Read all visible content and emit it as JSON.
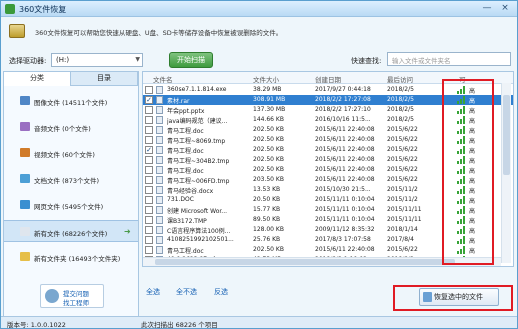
{
  "window": {
    "title": "360文件恢复",
    "minimize": "—",
    "close": "×"
  },
  "banner": {
    "text": "360文件恢复可以帮助您快速从硬盘、U盘、SD卡等储存设备中恢复被误删除的文件。"
  },
  "drivebar": {
    "drive_label": "选择驱动器:",
    "drive_value": "(H:)",
    "scan_button": "开始扫描",
    "search_label": "快速查找:",
    "search_placeholder": "输入文件或文件夹名"
  },
  "sidebar": {
    "tabs": [
      "分类",
      "目录"
    ],
    "active_tab": 0,
    "categories": [
      {
        "label": "图像文件 (14511个文件)",
        "icon": "image-icon",
        "color": "#4f86c6"
      },
      {
        "label": "音频文件 (0个文件)",
        "icon": "music-icon",
        "color": "#9a6fc2"
      },
      {
        "label": "视频文件 (60个文件)",
        "icon": "video-icon",
        "color": "#d07b2a"
      },
      {
        "label": "文档文件 (873个文件)",
        "icon": "document-icon",
        "color": "#4c9fd6"
      },
      {
        "label": "网页文件 (5495个文件)",
        "icon": "globe-icon",
        "color": "#3a8fd1"
      },
      {
        "label": "新有文件 (68226个文件)",
        "icon": "file-icon",
        "color": "#dfe6ee",
        "selected": true
      },
      {
        "label": "新有文件夹 (16493个文件夹)",
        "icon": "folder-icon",
        "color": "#e6bf4a"
      }
    ],
    "help": {
      "line1": "提交问题",
      "line2": "找工程师"
    }
  },
  "table": {
    "headers": {
      "name": "文件名",
      "size": "文件大小",
      "created": "创建日期",
      "accessed": "最后访问",
      "grade": "可"
    },
    "rows": [
      {
        "name": "360se7.1.1.814.exe",
        "size": "38.29 MB",
        "created": "2017/9/27 0:44:18",
        "accessed": "2018/2/5",
        "grade": "高",
        "checked": false
      },
      {
        "name": "素材.rar",
        "size": "308.91 MB",
        "created": "2018/2/2 17:27:08",
        "accessed": "2018/2/5",
        "grade": "高",
        "checked": true,
        "selected": true
      },
      {
        "name": "年会ppt.pptx",
        "size": "137.30 MB",
        "created": "2018/2/2 17:27:10",
        "accessed": "2018/2/5",
        "grade": "高",
        "checked": false
      },
      {
        "name": "java编码规范（建议...",
        "size": "144.66 KB",
        "created": "2016/10/16 11:5...",
        "accessed": "2018/2/5",
        "grade": "高",
        "checked": false
      },
      {
        "name": "青马工程.doc",
        "size": "202.50 KB",
        "created": "2015/6/11 22:40:08",
        "accessed": "2015/6/22",
        "grade": "高",
        "checked": false
      },
      {
        "name": "青马工程~8069.tmp",
        "size": "202.50 KB",
        "created": "2015/6/11 22:40:08",
        "accessed": "2015/6/22",
        "grade": "高",
        "checked": false
      },
      {
        "name": "青马工程.doc",
        "size": "202.50 KB",
        "created": "2015/6/11 22:40:08",
        "accessed": "2015/6/22",
        "grade": "高",
        "checked": true
      },
      {
        "name": "青马工程~304B2.tmp",
        "size": "202.50 KB",
        "created": "2015/6/11 22:40:08",
        "accessed": "2015/6/22",
        "grade": "高",
        "checked": false
      },
      {
        "name": "青马工程.doc",
        "size": "202.50 KB",
        "created": "2015/6/11 22:40:08",
        "accessed": "2015/6/22",
        "grade": "高",
        "checked": false
      },
      {
        "name": "青马工程~006FD.tmp",
        "size": "203.50 KB",
        "created": "2015/6/11 22:40:08",
        "accessed": "2015/6/22",
        "grade": "高",
        "checked": false
      },
      {
        "name": "青马经验谷.docx",
        "size": "13.53 KB",
        "created": "2015/10/30 21:5...",
        "accessed": "2015/11/2",
        "grade": "高",
        "checked": false
      },
      {
        "name": "731.DOC",
        "size": "20.50 KB",
        "created": "2015/11/11 0:10:04",
        "accessed": "2015/11/2",
        "grade": "高",
        "checked": false
      },
      {
        "name": "创建 Microsoft Wor...",
        "size": "15.77 KB",
        "created": "2015/11/11 0:10:04",
        "accessed": "2015/11/11",
        "grade": "高",
        "checked": false
      },
      {
        "name": "课B3172.TMP",
        "size": "89.50 KB",
        "created": "2015/11/11 0:10:04",
        "accessed": "2015/11/11",
        "grade": "高",
        "checked": false
      },
      {
        "name": "C语言程序算法100例...",
        "size": "128.00 KB",
        "created": "2009/11/12 8:35:32",
        "accessed": "2018/1/14",
        "grade": "高",
        "checked": false
      },
      {
        "name": "4108251992102501...",
        "size": "25.76 KB",
        "created": "2017/8/3 17:07:58",
        "accessed": "2017/8/4",
        "grade": "高",
        "checked": false
      },
      {
        "name": "青马工程.doc",
        "size": "202.50 KB",
        "created": "2015/6/11 22:40:08",
        "accessed": "2015/6/22",
        "grade": "高",
        "checked": false
      },
      {
        "name": "49.0.2623.87_chrom...",
        "size": "42.73 MB",
        "created": "2018/8/2 1:10:02",
        "accessed": "2018/8/2",
        "grade": "高",
        "checked": false
      }
    ]
  },
  "actions": {
    "select_all": "全选",
    "select_none": "全不选",
    "invert": "反选",
    "recover": "恢复选中的文件"
  },
  "status": {
    "version": "版本号: 1.0.0.1022",
    "scan_result": "此次扫描出 68226 个项目"
  },
  "colors": {
    "highlight_box": "#e01b24",
    "selected_row": "#2f7fd0",
    "signal": "#36a336"
  }
}
